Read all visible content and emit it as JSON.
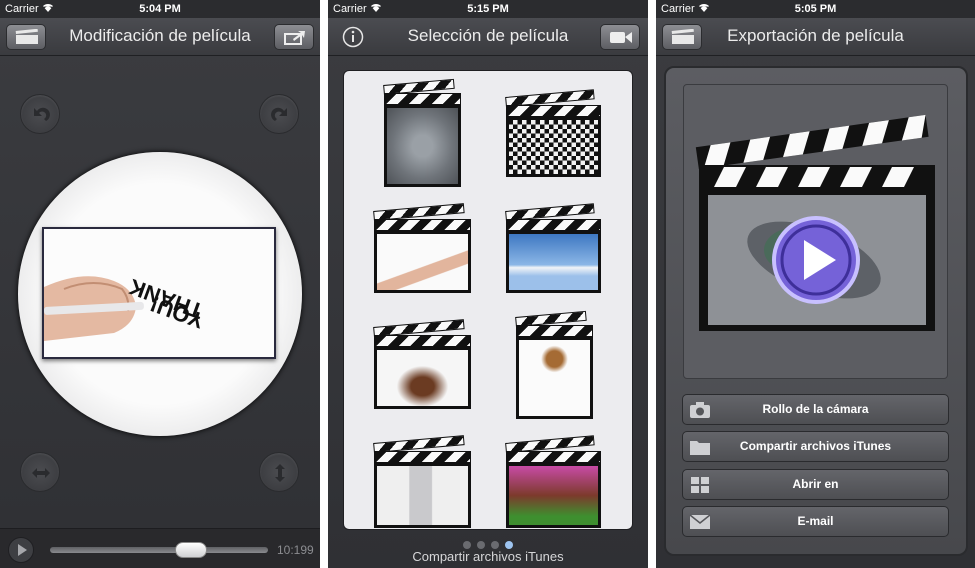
{
  "statusbar": [
    {
      "carrier": "Carrier",
      "time": "5:04 PM"
    },
    {
      "carrier": "Carrier",
      "time": "5:15 PM"
    },
    {
      "carrier": "Carrier",
      "time": "5:05 PM"
    }
  ],
  "screen1": {
    "title": "Modificación de película",
    "playback_time": "10:199",
    "slider_position": 0.67,
    "video_text": "THANK YOU!"
  },
  "screen2": {
    "title": "Selección de película",
    "page_dots": 4,
    "active_dot": 3,
    "footer_label": "Compartir archivos iTunes"
  },
  "screen3": {
    "title": "Exportación de película",
    "actions": [
      {
        "label": "Rollo de la cámara",
        "icon": "camera-icon"
      },
      {
        "label": "Compartir archivos iTunes",
        "icon": "folder-icon"
      },
      {
        "label": "Abrir en",
        "icon": "grid-icon"
      },
      {
        "label": "E-mail",
        "icon": "envelope-icon"
      }
    ]
  }
}
